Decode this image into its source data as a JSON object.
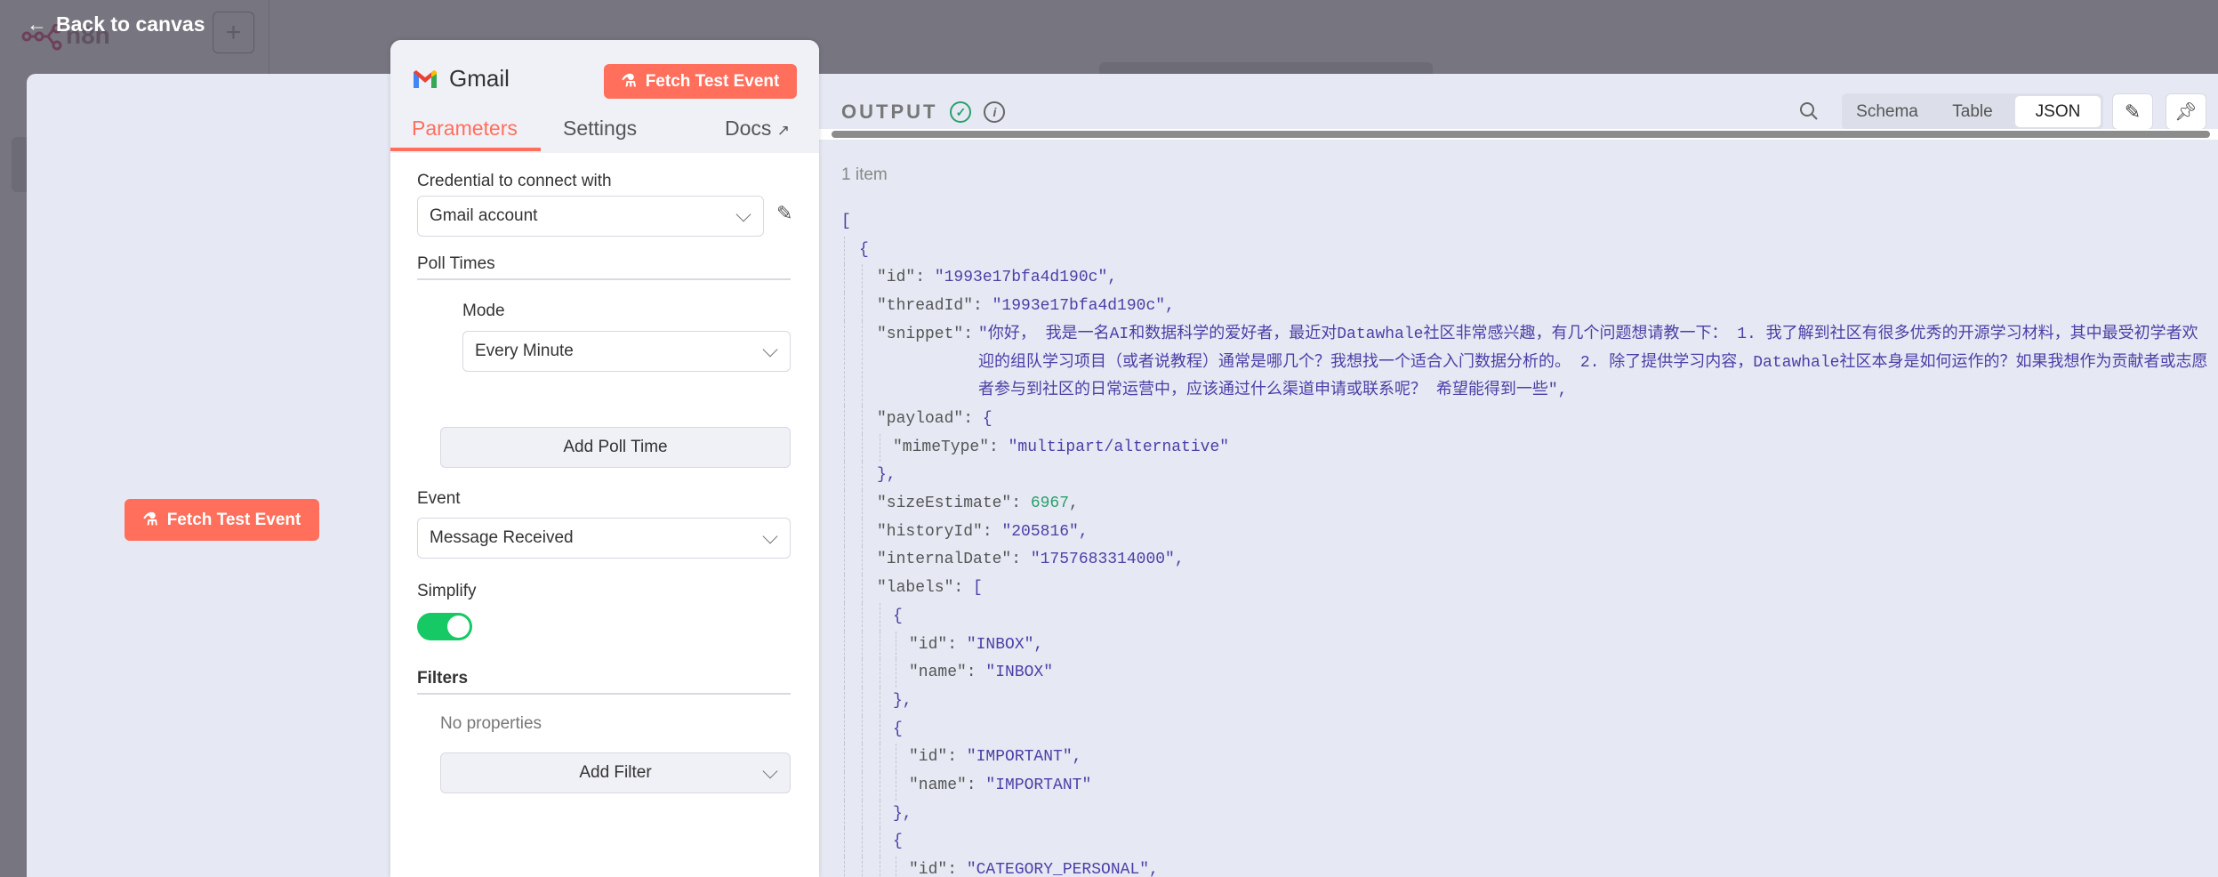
{
  "topbar": {
    "back_label": "Back to canvas",
    "logo_text": "n8n",
    "add_label": "+"
  },
  "input_panel": {
    "fetch_label": "Fetch Test Event"
  },
  "node": {
    "title": "Gmail",
    "fetch_label": "Fetch Test Event",
    "tabs": {
      "parameters": "Parameters",
      "settings": "Settings",
      "docs": "Docs"
    },
    "credential_label": "Credential to connect with",
    "credential_value": "Gmail account",
    "poll_times_label": "Poll Times",
    "mode_label": "Mode",
    "mode_value": "Every Minute",
    "add_poll_time": "Add Poll Time",
    "event_label": "Event",
    "event_value": "Message Received",
    "simplify_label": "Simplify",
    "simplify_on": true,
    "filters_label": "Filters",
    "no_properties": "No properties",
    "add_filter": "Add Filter"
  },
  "output": {
    "title": "OUTPUT",
    "views": {
      "schema": "Schema",
      "table": "Table",
      "json": "JSON"
    },
    "active_view": "JSON",
    "item_count": "1 item",
    "json_lines": [
      {
        "i": 0,
        "open": "["
      },
      {
        "i": 1,
        "open": "{"
      },
      {
        "i": 2,
        "key": "id",
        "s": "1993e17bfa4d190c",
        "c": ","
      },
      {
        "i": 2,
        "key": "threadId",
        "s": "1993e17bfa4d190c",
        "c": ","
      },
      {
        "i": 2,
        "key": "snippet",
        "s": "你好， 我是一名AI和数据科学的爱好者，最近对Datawhale社区非常感兴趣，有几个问题想请教一下： 1. 我了解到社区有很多优秀的开源学习材料，其中最受初学者欢迎的组队学习项目（或者说教程）通常是哪几个？我想找一个适合入门数据分析的。 2. 除了提供学习内容，Datawhale社区本身是如何运作的？如果我想作为贡献者或志愿者参与到社区的日常运营中，应该通过什么渠道申请或联系呢？ 希望能得到一些",
        "c": ",",
        "wrap": true
      },
      {
        "i": 2,
        "key": "payload",
        "open": "{"
      },
      {
        "i": 3,
        "key": "mimeType",
        "s": "multipart/alternative"
      },
      {
        "i": 2,
        "open": "}",
        "c": ","
      },
      {
        "i": 2,
        "key": "sizeEstimate",
        "n": "6967",
        "c": ","
      },
      {
        "i": 2,
        "key": "historyId",
        "s": "205816",
        "c": ","
      },
      {
        "i": 2,
        "key": "internalDate",
        "s": "1757683314000",
        "c": ","
      },
      {
        "i": 2,
        "key": "labels",
        "open": "["
      },
      {
        "i": 3,
        "open": "{"
      },
      {
        "i": 4,
        "key": "id",
        "s": "INBOX",
        "c": ","
      },
      {
        "i": 4,
        "key": "name",
        "s": "INBOX"
      },
      {
        "i": 3,
        "open": "}",
        "c": ","
      },
      {
        "i": 3,
        "open": "{"
      },
      {
        "i": 4,
        "key": "id",
        "s": "IMPORTANT",
        "c": ","
      },
      {
        "i": 4,
        "key": "name",
        "s": "IMPORTANT"
      },
      {
        "i": 3,
        "open": "}",
        "c": ","
      },
      {
        "i": 3,
        "open": "{"
      },
      {
        "i": 4,
        "key": "id",
        "s": "CATEGORY_PERSONAL",
        "c": ","
      }
    ]
  }
}
